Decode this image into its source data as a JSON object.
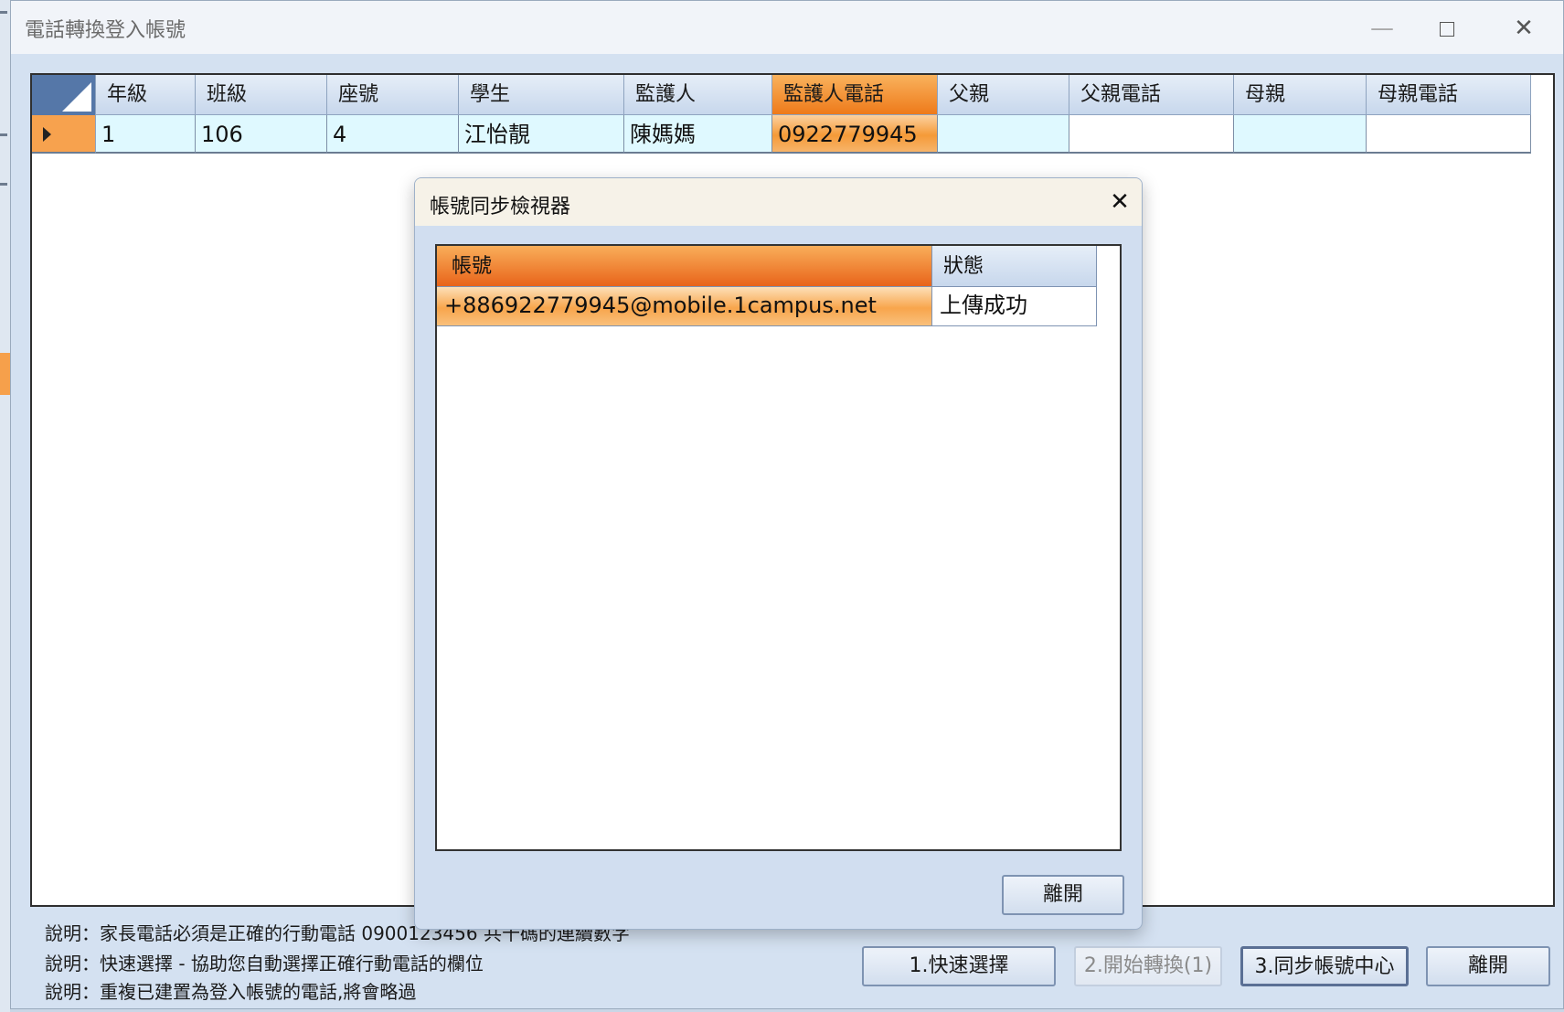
{
  "window": {
    "title": "電話轉換登入帳號",
    "minimize_glyph": "—",
    "close_glyph": "✕"
  },
  "grid": {
    "columns": [
      "年級",
      "班級",
      "座號",
      "學生",
      "監護人",
      "監護人電話",
      "父親",
      "父親電話",
      "母親",
      "母親電話"
    ],
    "rows": [
      [
        "1",
        "106",
        "4",
        "江怡靚",
        "陳媽媽",
        "0922779945",
        "",
        "",
        "",
        ""
      ]
    ],
    "selected_column": "監護人電話"
  },
  "notes": [
    "說明：家長電話必須是正確的行動電話 0900123456 共十碼的連續數字",
    "說明：快速選擇 - 協助您自動選擇正確行動電話的欄位",
    "說明：重複已建置為登入帳號的電話,將會略過"
  ],
  "buttons": {
    "quick_select": "1.快速選擇",
    "start_convert": "2.開始轉換(1)",
    "sync_center": "3.同步帳號中心",
    "leave": "離開"
  },
  "dialog": {
    "title": "帳號同步檢視器",
    "close_glyph": "✕",
    "columns": [
      "帳號",
      "狀態"
    ],
    "rows": [
      [
        "+886922779945@mobile.1campus.net",
        "上傳成功"
      ]
    ],
    "leave_button": "離開"
  },
  "colors": {
    "selection_orange": "#f59a38",
    "row_cyan": "#dff9ff",
    "header_blue": "#c7d7ec"
  },
  "icons": [
    "row-pointer-icon",
    "window-minimize-icon",
    "window-maximize-icon",
    "window-close-icon",
    "dialog-close-icon"
  ]
}
